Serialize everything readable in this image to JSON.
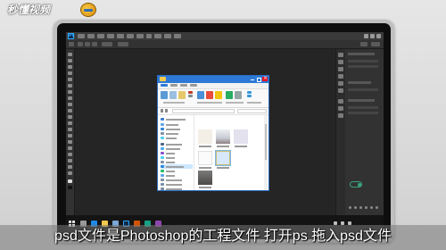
{
  "watermark": {
    "text": "秒懂视频"
  },
  "subtitle": "psd文件是Photoshop的工程文件 打开ps 拖入psd文件",
  "photoshop": {
    "app_icon": "Ps",
    "menus": [
      "file",
      "edit",
      "image",
      "layer",
      "type",
      "select",
      "filter",
      "3d",
      "view",
      "window",
      "help"
    ]
  },
  "explorer": {
    "title": "",
    "icons": {
      "folder": "folder-icon",
      "minimize": "minimize-icon",
      "maximize": "maximize-icon",
      "close": "close-icon"
    },
    "sidebar_items": [
      "quick-access",
      "desktop",
      "downloads",
      "documents",
      "pictures",
      "this-pc",
      "3d-objects",
      "videos",
      "pictures",
      "documents",
      "downloads",
      "music",
      "desktop",
      "local-disk",
      "local-disk",
      "local-disk",
      "local-disk",
      "network"
    ],
    "files": [
      "image-1",
      "image-2",
      "image-3",
      "image-4",
      "psd-file",
      "image-6"
    ]
  },
  "taskbar": {
    "start_icon": "windows-start-icon",
    "time": "",
    "apps": [
      "task-view-icon",
      "browser-icon",
      "folder-icon",
      "store-icon",
      "photoshop-icon",
      "app-icon",
      "app-icon",
      "app-icon"
    ]
  }
}
